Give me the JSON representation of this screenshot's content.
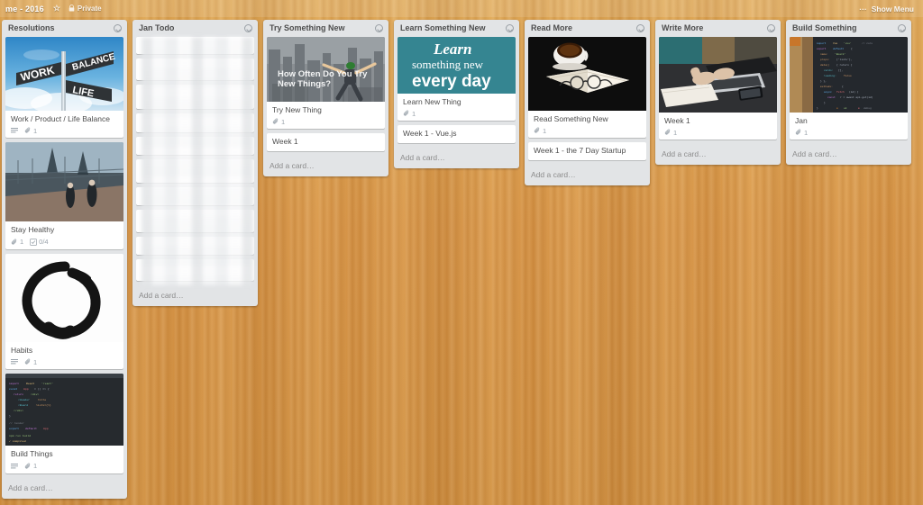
{
  "header": {
    "board_title": "me - 2016",
    "star_icon": "star-icon",
    "lock_icon": "lock-icon",
    "visibility": "Private",
    "show_menu_label": "Show Menu",
    "menu_dash": "···"
  },
  "board": {
    "background_color": "#d99a45",
    "list_background": "#e2e4e6",
    "card_background": "#ffffff",
    "add_card_label": "Add a card…",
    "lists": [
      {
        "title": "Resolutions",
        "menu_icon": "list-menu-icon",
        "add_card": "Add a card…",
        "cards": [
          {
            "title": "Work / Product / Life Balance",
            "cover": "signpost-work-balance-life",
            "cover_height": 82,
            "has_description": true,
            "attachments": "1",
            "checklist": null
          },
          {
            "title": "Stay Healthy",
            "cover": "bridge-runners-photo",
            "cover_height": 88,
            "has_description": false,
            "attachments": "1",
            "checklist": "0/4"
          },
          {
            "title": "Habits",
            "cover": "enso-brush-circle",
            "cover_height": 98,
            "has_description": true,
            "attachments": "1",
            "checklist": null
          },
          {
            "title": "Build Things",
            "cover": "code-editor-screenshot",
            "cover_height": 80,
            "has_description": true,
            "attachments": "1",
            "checklist": null
          }
        ]
      },
      {
        "title": "Jan Todo",
        "menu_icon": "list-menu-icon",
        "add_card": "Add a card…",
        "blurred": true,
        "blurred_card_count": 10,
        "cards": []
      },
      {
        "title": "Try Something New",
        "menu_icon": "list-menu-icon",
        "add_card": "Add a card…",
        "cards": [
          {
            "title": "Try New Thing",
            "cover": "basejump-how-often-do-you-try-new-things",
            "cover_text": "How Often Do You Try New Things?",
            "cover_height": 72,
            "has_description": false,
            "attachments": "1",
            "checklist": null
          },
          {
            "title": "Week 1",
            "cover": null,
            "has_description": false,
            "attachments": null,
            "checklist": null
          }
        ]
      },
      {
        "title": "Learn Something New",
        "menu_icon": "list-menu-icon",
        "add_card": "Add a card…",
        "cards": [
          {
            "title": "Learn New Thing",
            "cover": "learn-something-new-every-day-poster",
            "cover_text": "Learn something new every day",
            "cover_height": 63,
            "has_description": false,
            "attachments": "1",
            "checklist": null
          },
          {
            "title": "Week 1 - Vue.js",
            "cover": null,
            "has_description": false,
            "attachments": null,
            "checklist": null
          }
        ]
      },
      {
        "title": "Read More",
        "menu_icon": "list-menu-icon",
        "add_card": "Add a card…",
        "cards": [
          {
            "title": "Read Something New",
            "cover": "coffee-book-glasses-photo",
            "cover_height": 82,
            "has_description": false,
            "attachments": "1",
            "checklist": null
          },
          {
            "title": "Week 1 - the 7 Day Startup",
            "cover": null,
            "has_description": false,
            "attachments": null,
            "checklist": null
          }
        ]
      },
      {
        "title": "Write More",
        "menu_icon": "list-menu-icon",
        "add_card": "Add a card…",
        "cards": [
          {
            "title": "Week 1",
            "cover": "laptop-typing-hands-photo",
            "cover_height": 84,
            "has_description": false,
            "attachments": "1",
            "checklist": null
          }
        ]
      },
      {
        "title": "Build Something",
        "menu_icon": "list-menu-icon",
        "add_card": "Add a card…",
        "cards": [
          {
            "title": "Jan",
            "cover": "code-on-dark-screen-photo",
            "cover_height": 84,
            "has_description": false,
            "attachments": "1",
            "checklist": null
          }
        ]
      }
    ]
  }
}
